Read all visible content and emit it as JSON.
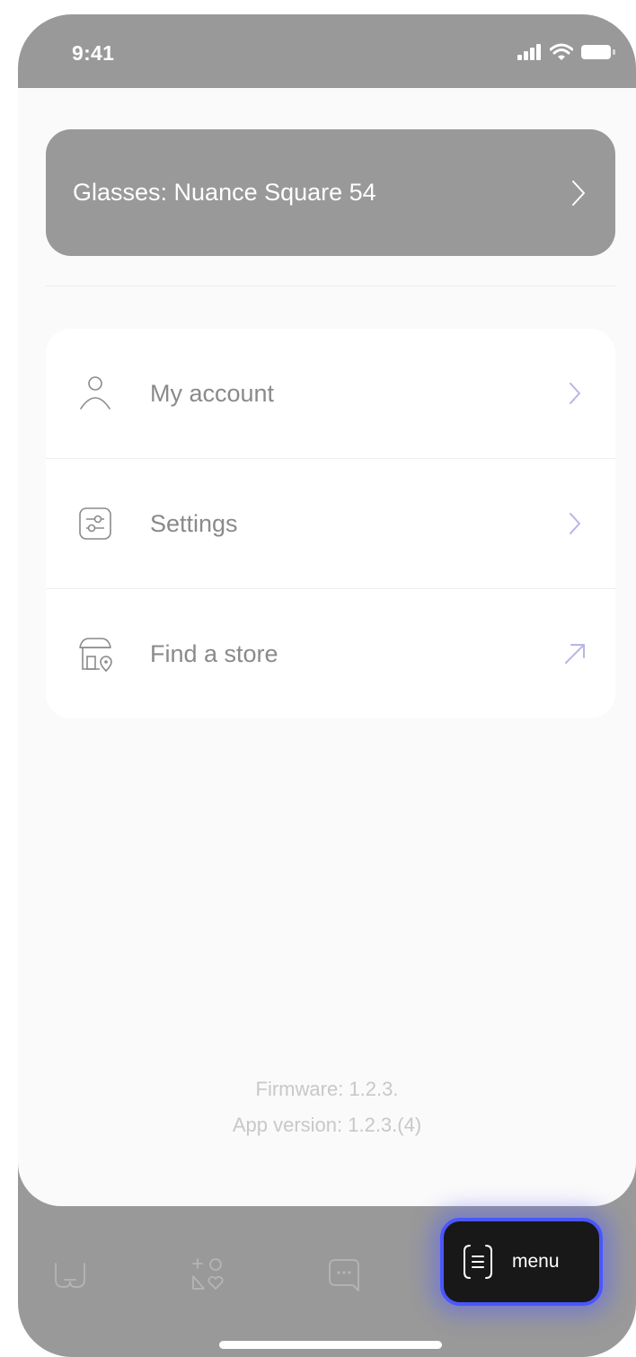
{
  "status_bar": {
    "time": "9:41",
    "icons": [
      "signal-icon",
      "wifi-icon",
      "battery-icon"
    ]
  },
  "glasses_card": {
    "label": "Glasses: Nuance Square 54",
    "icon": "chevron-right-icon"
  },
  "menu": {
    "items": [
      {
        "label": "My account",
        "icon": "user-icon",
        "action_icon": "chevron-right-icon"
      },
      {
        "label": "Settings",
        "icon": "sliders-icon",
        "action_icon": "chevron-right-icon"
      },
      {
        "label": "Find a store",
        "icon": "store-location-icon",
        "action_icon": "external-arrow-icon"
      }
    ]
  },
  "footer": {
    "firmware": "Firmware: 1.2.3.",
    "app_version": "App version: 1.2.3.(4)"
  },
  "tabbar": {
    "tabs": [
      {
        "icon": "glasses-icon"
      },
      {
        "icon": "shapes-icon"
      },
      {
        "icon": "chat-icon"
      },
      {
        "icon": "menu-list-icon",
        "label": "menu",
        "active": true
      }
    ]
  },
  "colors": {
    "frame": "#999999",
    "sheet": "#fafafa",
    "accent_chevron": "#b8b5e8",
    "active_tab_border": "#4a57ff",
    "active_tab_bg": "#181818"
  }
}
